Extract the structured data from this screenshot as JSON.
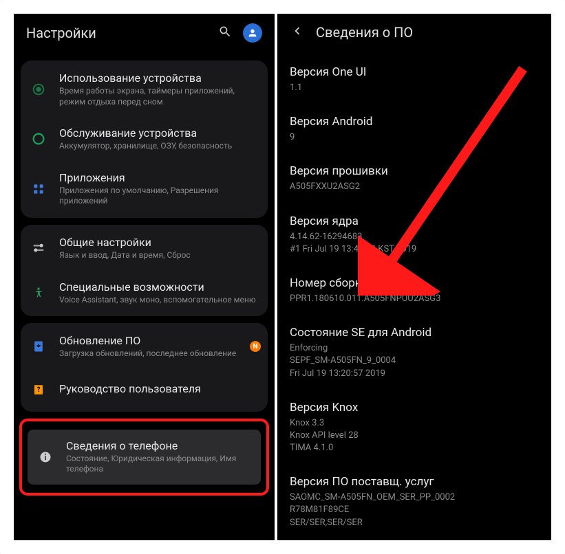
{
  "left": {
    "header": {
      "title": "Настройки"
    },
    "groups": [
      {
        "items": [
          {
            "icon": "usage",
            "title": "Использование устройства",
            "sub": "Время работы экрана, таймеры приложений, режим отдыха перед сном"
          },
          {
            "icon": "care",
            "title": "Обслуживание устройства",
            "sub": "Аккумулятор, хранилище, ОЗУ, безопасность"
          },
          {
            "icon": "apps",
            "title": "Приложения",
            "sub": "Приложения по умолчанию, Разрешения приложений"
          }
        ]
      },
      {
        "items": [
          {
            "icon": "general",
            "title": "Общие настройки",
            "sub": "Язык и ввод, Дата и время, Сброс"
          },
          {
            "icon": "access",
            "title": "Специальные возможности",
            "sub": "Voice Assistant, звук моно, вспомогательное меню"
          }
        ]
      },
      {
        "items": [
          {
            "icon": "update",
            "title": "Обновление ПО",
            "sub": "Загрузка обновлений, последнее обновление",
            "badge": "N"
          },
          {
            "icon": "manual",
            "title": "Руководство пользователя",
            "sub": ""
          }
        ]
      }
    ],
    "highlight": {
      "icon": "about",
      "title": "Сведения о телефоне",
      "sub": "Состояние, Юридическая информация, Имя телефона"
    }
  },
  "right": {
    "header": {
      "title": "Сведения о ПО"
    },
    "items": [
      {
        "title": "Версия One UI",
        "value": "1.1"
      },
      {
        "title": "Версия Android",
        "value": "9"
      },
      {
        "title": "Версия прошивки",
        "value": "A505FXXU2ASG2"
      },
      {
        "title": "Версия ядра",
        "value": "4.14.62-16294683\n#1 Fri Jul 19 13:44:54 KST 2019"
      },
      {
        "title": "Номер сборки",
        "value": "PPR1.180610.011.A505FNPUU2ASG3"
      },
      {
        "title": "Состояние SE для Android",
        "value": "Enforcing\nSEPF_SM-A505FN_9_0004\nFri Jul 19 13:20:57 2019"
      },
      {
        "title": "Версия Knox",
        "value": "Knox 3.3\nKnox API level 28\nTIMA 4.1.0"
      },
      {
        "title": "Версия ПО поставщ. услуг",
        "value": "SAOMC_SM-A505FN_OEM_SER_PP_0002\nR78M81F89CE\nSER/SER,SER/SER"
      }
    ]
  }
}
